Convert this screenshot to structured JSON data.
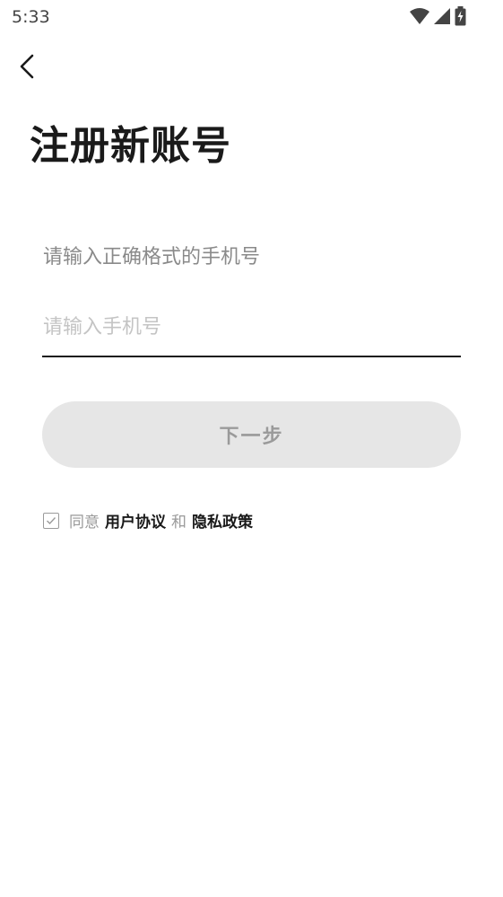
{
  "status_bar": {
    "time": "5:33",
    "icons": [
      "wifi-icon",
      "cellular-signal-icon",
      "battery-charging-icon"
    ]
  },
  "header": {
    "back_icon": "chevron-left-icon",
    "title": "注册新账号"
  },
  "form": {
    "hint": "请输入正确格式的手机号",
    "phone_placeholder": "请输入手机号",
    "phone_value": "",
    "next_label": "下一步"
  },
  "agreement": {
    "checked": true,
    "prefix": "同意",
    "user_agreement": "用户协议",
    "connector": "和",
    "privacy_policy": "隐私政策"
  },
  "colors": {
    "title": "#1a1a1a",
    "muted_text": "#8a8a8a",
    "button_bg": "#e6e6e6",
    "button_text": "#9a9a9a",
    "underline": "#1a1a1a"
  }
}
